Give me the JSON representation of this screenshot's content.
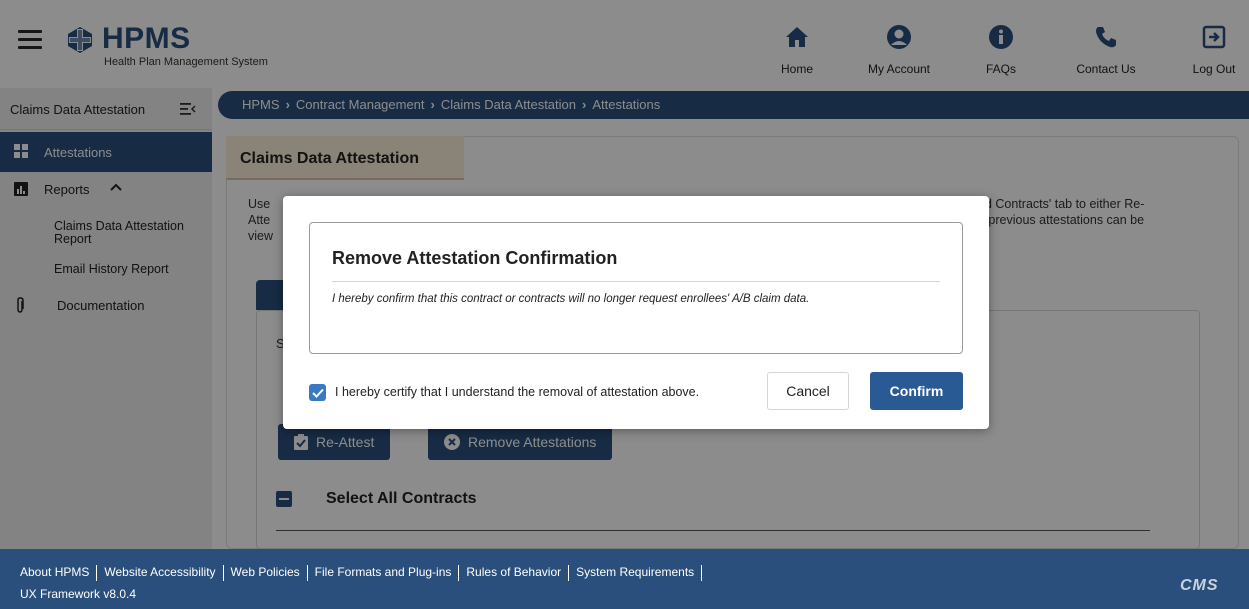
{
  "header": {
    "logo_title": "HPMS",
    "logo_subtitle": "Health Plan Management System",
    "nav": [
      {
        "label": "Home",
        "icon": "home-icon"
      },
      {
        "label": "My Account",
        "icon": "user-icon"
      },
      {
        "label": "FAQs",
        "icon": "info-icon"
      },
      {
        "label": "Contact Us",
        "icon": "phone-icon"
      },
      {
        "label": "Log Out",
        "icon": "logout-icon"
      }
    ]
  },
  "sidebar": {
    "title": "Claims Data Attestation",
    "items": [
      {
        "label": "Attestations",
        "icon": "grid-icon",
        "active": true
      },
      {
        "label": "Reports",
        "icon": "bar-chart-icon",
        "expanded": true
      },
      {
        "label": "Claims Data Attestation Report"
      },
      {
        "label": "Email History Report"
      },
      {
        "label": "Documentation",
        "icon": "paperclip-icon"
      }
    ]
  },
  "breadcrumb": [
    "HPMS",
    "Contract Management",
    "Claims Data Attestation",
    "Attestations"
  ],
  "main": {
    "page_tab": "Claims Data Attestation",
    "intro_left": [
      "Use",
      "Atte",
      "view"
    ],
    "intro_right": [
      "ed Contracts' tab to either Re-",
      "n previous attestations can be"
    ],
    "inner_s": "S",
    "reattest_label": "Re-Attest",
    "remove_label": "Remove Attestations",
    "select_all_label": "Select All Contracts"
  },
  "modal": {
    "title": "Remove Attestation Confirmation",
    "text": "I hereby confirm that this contract or contracts will no longer request enrollees' A/B claim data.",
    "checkbox_label": "I hereby certify that I understand the removal of attestation above.",
    "checkbox_checked": true,
    "cancel_label": "Cancel",
    "confirm_label": "Confirm"
  },
  "footer": {
    "links": [
      "About HPMS",
      "Website Accessibility",
      "Web Policies",
      "File Formats and Plug-ins",
      "Rules of Behavior",
      "System Requirements"
    ],
    "version": "UX Framework v8.0.4",
    "logo_text": "CMS"
  },
  "colors": {
    "primary": "#2a4f7c",
    "confirm": "#2a5a93",
    "checkbox": "#3a78c2",
    "tab_bg": "#fbeed9"
  }
}
